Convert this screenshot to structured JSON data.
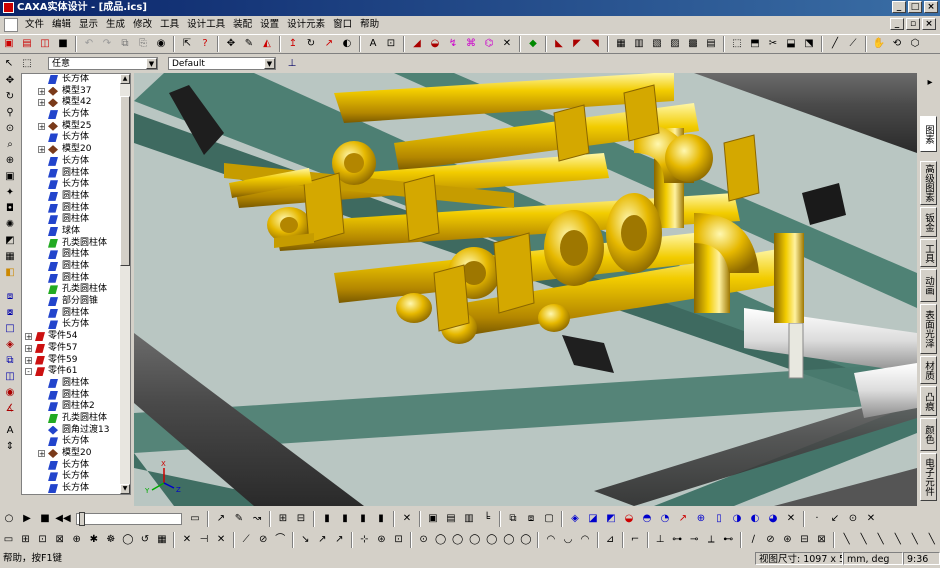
{
  "window": {
    "title": "CAXA实体设计 - [成品.ics]"
  },
  "menu": [
    "文件",
    "编辑",
    "显示",
    "生成",
    "修改",
    "工具",
    "设计工具",
    "装配",
    "设置",
    "设计元素",
    "窗口",
    "帮助"
  ],
  "selectors": {
    "filter_value": "任意",
    "style_value": "Default"
  },
  "tree": [
    {
      "label": "长方体",
      "icon": "box-icon",
      "indent": 1,
      "expander": ""
    },
    {
      "label": "模型37",
      "icon": "model-icon",
      "indent": 0,
      "expander": "+"
    },
    {
      "label": "模型42",
      "icon": "model-icon",
      "indent": 0,
      "expander": "+"
    },
    {
      "label": "长方体",
      "icon": "box-icon",
      "indent": 1,
      "expander": ""
    },
    {
      "label": "模型25",
      "icon": "model-icon",
      "indent": 0,
      "expander": "+"
    },
    {
      "label": "长方体",
      "icon": "box-icon",
      "indent": 1,
      "expander": ""
    },
    {
      "label": "模型20",
      "icon": "model-icon",
      "indent": 0,
      "expander": "+"
    },
    {
      "label": "长方体",
      "icon": "box-icon",
      "indent": 1,
      "expander": ""
    },
    {
      "label": "圆柱体",
      "icon": "cylinder-icon",
      "indent": 1,
      "expander": ""
    },
    {
      "label": "长方体",
      "icon": "box-icon",
      "indent": 1,
      "expander": ""
    },
    {
      "label": "圆柱体",
      "icon": "cylinder-icon",
      "indent": 1,
      "expander": ""
    },
    {
      "label": "圆柱体",
      "icon": "cylinder-icon",
      "indent": 1,
      "expander": ""
    },
    {
      "label": "圆柱体",
      "icon": "cylinder-icon",
      "indent": 1,
      "expander": ""
    },
    {
      "label": "球体",
      "icon": "sphere-icon",
      "indent": 1,
      "expander": ""
    },
    {
      "label": "孔类圆柱体",
      "icon": "hole-cylinder-icon",
      "indent": 1,
      "expander": ""
    },
    {
      "label": "圆柱体",
      "icon": "cylinder-icon",
      "indent": 1,
      "expander": ""
    },
    {
      "label": "圆柱体",
      "icon": "cylinder-icon",
      "indent": 1,
      "expander": ""
    },
    {
      "label": "圆柱体",
      "icon": "cylinder-icon",
      "indent": 1,
      "expander": ""
    },
    {
      "label": "孔类圆柱体",
      "icon": "hole-cylinder-icon",
      "indent": 1,
      "expander": ""
    },
    {
      "label": "部分圆锥",
      "icon": "cone-icon",
      "indent": 1,
      "expander": ""
    },
    {
      "label": "圆柱体",
      "icon": "cylinder-icon",
      "indent": 1,
      "expander": ""
    },
    {
      "label": "长方体",
      "icon": "box-icon",
      "indent": 1,
      "expander": ""
    },
    {
      "label": "零件54",
      "icon": "part-icon",
      "indent": -1,
      "expander": "+"
    },
    {
      "label": "零件57",
      "icon": "part-icon",
      "indent": -1,
      "expander": "+"
    },
    {
      "label": "零件59",
      "icon": "part-icon",
      "indent": -1,
      "expander": "+"
    },
    {
      "label": "零件61",
      "icon": "part-icon",
      "indent": -1,
      "expander": "-"
    },
    {
      "label": "圆柱体",
      "icon": "cylinder-icon",
      "indent": 1,
      "expander": ""
    },
    {
      "label": "圆柱体",
      "icon": "cylinder-icon",
      "indent": 1,
      "expander": ""
    },
    {
      "label": "圆柱体2",
      "icon": "cylinder-icon",
      "indent": 1,
      "expander": ""
    },
    {
      "label": "孔类圆柱体",
      "icon": "hole-cylinder-icon",
      "indent": 1,
      "expander": ""
    },
    {
      "label": "圆角过渡13",
      "icon": "fillet-icon",
      "indent": 1,
      "expander": ""
    },
    {
      "label": "长方体",
      "icon": "box-icon",
      "indent": 1,
      "expander": ""
    },
    {
      "label": "模型20",
      "icon": "model-icon",
      "indent": 0,
      "expander": "+"
    },
    {
      "label": "长方体",
      "icon": "box-icon",
      "indent": 1,
      "expander": ""
    },
    {
      "label": "长方体",
      "icon": "box-icon",
      "indent": 1,
      "expander": ""
    },
    {
      "label": "长方体",
      "icon": "box-icon",
      "indent": 1,
      "expander": ""
    }
  ],
  "right_tabs": [
    "图素",
    "高级图素",
    "钣金",
    "工具",
    "动画",
    "表面光泽",
    "材质",
    "凸痕",
    "颜色",
    "电子元件"
  ],
  "triad": {
    "x": "X",
    "y": "Y",
    "z": "Z"
  },
  "status": {
    "help": "帮助，按F1键",
    "view_size": "视图尺寸: 1097 x 595",
    "units": "mm, deg",
    "time": "9:36"
  },
  "colors": {
    "pipe": "#e6b800",
    "frame": "#4d7f73",
    "floor": "#b9c6c2",
    "titlebar": "#0a246a"
  }
}
